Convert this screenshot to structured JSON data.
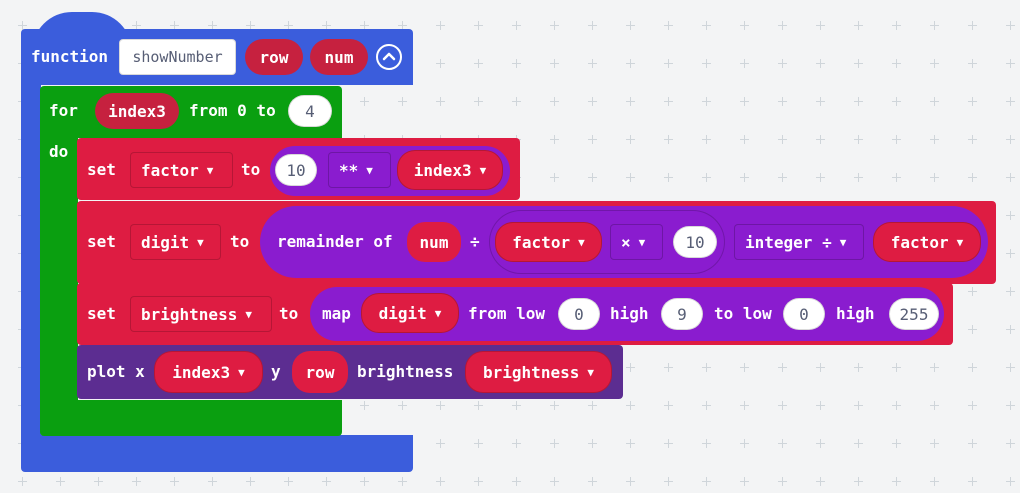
{
  "function_block": {
    "keyword": "function",
    "name": "showNumber",
    "params": [
      "row",
      "num"
    ],
    "color": "#3b5ddc"
  },
  "for_block": {
    "keyword_for": "for",
    "var": "index3",
    "from_label": "from 0 to",
    "to_value": "4",
    "keyword_do": "do",
    "color": "#0a9f10"
  },
  "set_factor": {
    "keyword": "set",
    "var": "factor",
    "to_label": "to",
    "left": "10",
    "op": "**",
    "right": "index3",
    "color": "#de1c42"
  },
  "set_digit": {
    "keyword": "set",
    "var": "digit",
    "to_label": "to",
    "remainder_label": "remainder of",
    "num": "num",
    "div_sign": "÷",
    "factor": "factor",
    "mul_op": "×",
    "ten": "10",
    "int_div": "integer ÷",
    "factor2": "factor"
  },
  "set_brightness": {
    "keyword": "set",
    "var": "brightness",
    "to_label": "to",
    "map_label": "map",
    "digit": "digit",
    "from_low_label": "from low",
    "from_low": "0",
    "high_label": "high",
    "from_high": "9",
    "to_low_label": "to low",
    "to_low": "0",
    "high_label2": "high",
    "to_high": "255"
  },
  "plot_block": {
    "keyword": "plot x",
    "x": "index3",
    "y_label": "y",
    "y": "row",
    "brightness_label": "brightness",
    "brightness": "brightness",
    "color": "#5c2d91"
  }
}
